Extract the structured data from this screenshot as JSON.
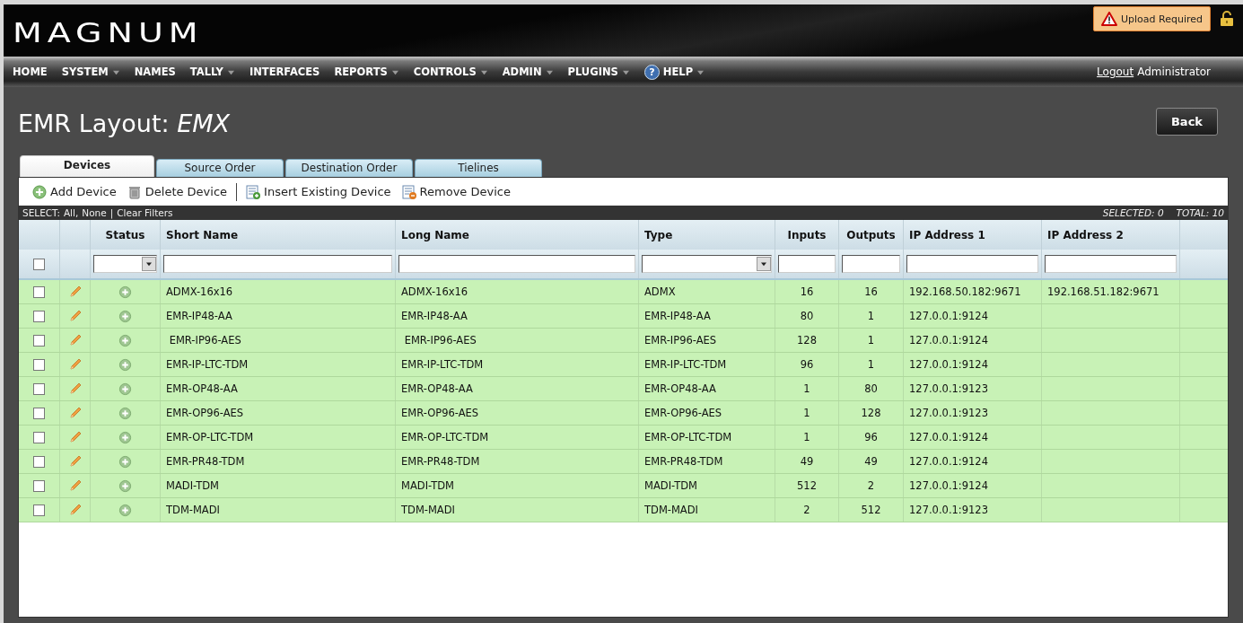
{
  "header": {
    "logo": "MAGNUM",
    "alert": "Upload Required"
  },
  "nav": {
    "items": [
      {
        "label": "HOME",
        "has_menu": false
      },
      {
        "label": "SYSTEM",
        "has_menu": true
      },
      {
        "label": "NAMES",
        "has_menu": false
      },
      {
        "label": "TALLY",
        "has_menu": true
      },
      {
        "label": "INTERFACES",
        "has_menu": false
      },
      {
        "label": "REPORTS",
        "has_menu": true
      },
      {
        "label": "CONTROLS",
        "has_menu": true
      },
      {
        "label": "ADMIN",
        "has_menu": true
      },
      {
        "label": "PLUGINS",
        "has_menu": true
      },
      {
        "label": "HELP",
        "has_menu": true,
        "kind": "help",
        "icon_text": "?"
      }
    ],
    "logout": "Logout",
    "user": "Administrator"
  },
  "page": {
    "title": "EMR Layout: *EMX*",
    "back": "Back"
  },
  "tabs": [
    {
      "label": "Devices",
      "selected": true
    },
    {
      "label": "Source Order",
      "selected": false
    },
    {
      "label": "Destination Order",
      "selected": false
    },
    {
      "label": "Tielines",
      "selected": false
    }
  ],
  "toolbar": [
    {
      "label": "Add Device",
      "kind": "add"
    },
    {
      "label": "Delete Device",
      "kind": "delete"
    },
    {
      "label": "Insert Existing Device",
      "kind": "insert"
    },
    {
      "label": "Remove Device",
      "kind": "remove"
    }
  ],
  "select_bar": {
    "prefix": "SELECT:",
    "all": "All",
    "separator_1": ",",
    "none": "None",
    "separator_2": "|",
    "clear": "Clear Filters",
    "selected": "SELECTED: 0",
    "total": "TOTAL: 10"
  },
  "table": {
    "select_all_checked": false,
    "status_column": {
      "label": "Status",
      "kind": "select"
    },
    "columns": [
      {
        "label": "Short Name",
        "kind": "text"
      },
      {
        "label": "Long Name",
        "kind": "text"
      },
      {
        "label": "Type",
        "kind": "select"
      },
      {
        "label": "Inputs",
        "kind": "text"
      },
      {
        "label": "Outputs",
        "kind": "text"
      },
      {
        "label": "IP Address 1",
        "kind": "text"
      },
      {
        "label": "IP Address 2",
        "kind": "text"
      }
    ],
    "rows": [
      {
        "checked": false,
        "cells": [
          "ADMX-16x16",
          "ADMX-16x16",
          "ADMX",
          "16",
          "16",
          "192.168.50.182:9671",
          "192.168.51.182:9671"
        ]
      },
      {
        "checked": false,
        "cells": [
          "EMR-IP48-AA",
          "EMR-IP48-AA",
          "EMR-IP48-AA",
          "80",
          "1",
          "127.0.0.1:9124",
          ""
        ]
      },
      {
        "checked": false,
        "cells": [
          " EMR-IP96-AES",
          " EMR-IP96-AES",
          "EMR-IP96-AES",
          "128",
          "1",
          "127.0.0.1:9124",
          ""
        ]
      },
      {
        "checked": false,
        "cells": [
          "EMR-IP-LTC-TDM",
          "EMR-IP-LTC-TDM",
          "EMR-IP-LTC-TDM",
          "96",
          "1",
          "127.0.0.1:9124",
          ""
        ]
      },
      {
        "checked": false,
        "cells": [
          "EMR-OP48-AA",
          "EMR-OP48-AA",
          "EMR-OP48-AA",
          "1",
          "80",
          "127.0.0.1:9123",
          ""
        ]
      },
      {
        "checked": false,
        "cells": [
          "EMR-OP96-AES",
          "EMR-OP96-AES",
          "EMR-OP96-AES",
          "1",
          "128",
          "127.0.0.1:9123",
          ""
        ]
      },
      {
        "checked": false,
        "cells": [
          "EMR-OP-LTC-TDM",
          "EMR-OP-LTC-TDM",
          "EMR-OP-LTC-TDM",
          "1",
          "96",
          "127.0.0.1:9124",
          ""
        ]
      },
      {
        "checked": false,
        "cells": [
          "EMR-PR48-TDM",
          "EMR-PR48-TDM",
          "EMR-PR48-TDM",
          "49",
          "49",
          "127.0.0.1:9124",
          ""
        ]
      },
      {
        "checked": false,
        "cells": [
          "MADI-TDM",
          "MADI-TDM",
          "MADI-TDM",
          "512",
          "2",
          "127.0.0.1:9124",
          ""
        ]
      },
      {
        "checked": false,
        "cells": [
          "TDM-MADI",
          "TDM-MADI",
          "TDM-MADI",
          "2",
          "512",
          "127.0.0.1:9123",
          ""
        ]
      }
    ]
  }
}
